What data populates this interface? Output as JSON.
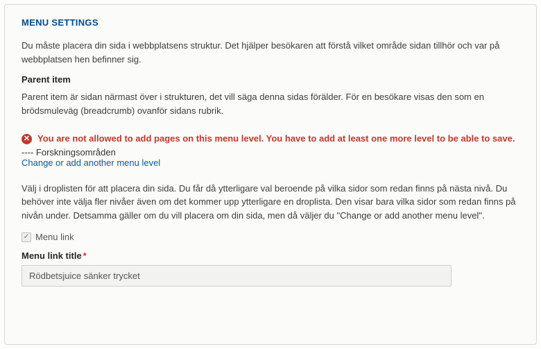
{
  "section": {
    "title": "MENU SETTINGS",
    "intro": "Du måste placera din sida i webbplatsens struktur. Det hjälper besökaren att förstå vilket område sidan tillhör och var på webbplatsen hen befinner sig.",
    "parent_heading": "Parent item",
    "parent_desc": "Parent item är sidan närmast över i strukturen, det vill säga denna sidas förälder. För en besökare visas den som en brödsmuleväg (breadcrumb) ovanför sidans rubrik.",
    "error_icon_glyph": "✕",
    "error_text": "You are not allowed to add pages on this menu level. You have to add at least one more level to be able to save.",
    "selected_path": "---- Forskningsområden",
    "change_link": "Change or add another menu level",
    "droplist_help": "Välj i droplisten för att placera din sida. Du får då ytterligare val beroende på vilka sidor som redan finns på nästa nivå. Du behöver inte välja fler nivåer även om det kommer upp ytterligare en droplista. Den visar bara vilka sidor som redan finns på nivån under. Detsamma gäller om du vill placera om din sida, men då väljer du \"Change or add another menu level\".",
    "menu_link_check_glyph": "✓",
    "menu_link_label": "Menu link",
    "menu_link_title_label": "Menu link title",
    "required_mark": "*",
    "menu_link_title_value": "Rödbetsjuice sänker trycket"
  }
}
